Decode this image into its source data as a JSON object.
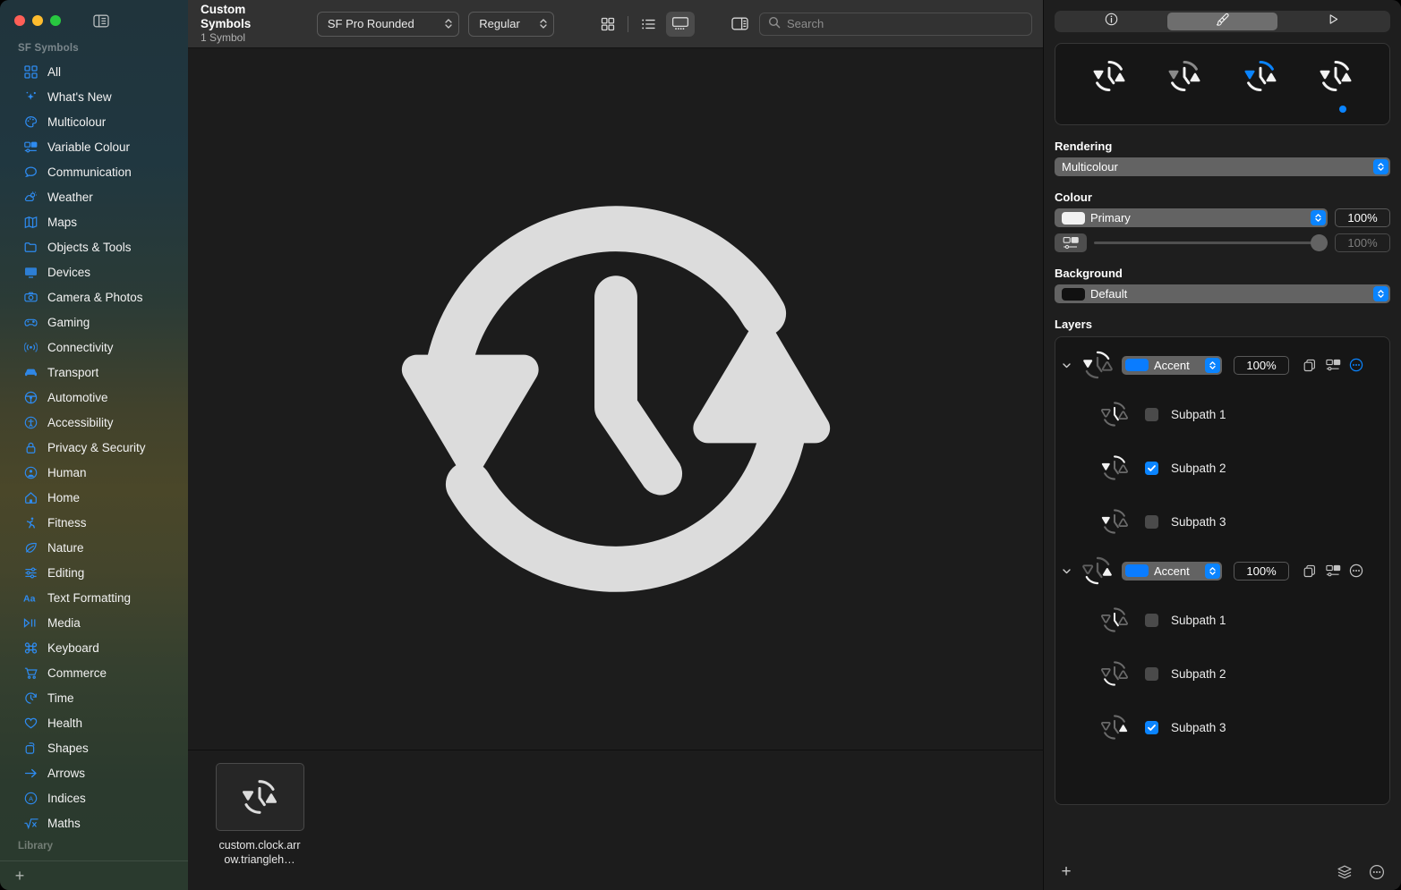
{
  "window": {
    "traffic_lights": [
      "close",
      "minimize",
      "zoom"
    ],
    "accent_color": "#0a84ff"
  },
  "sidebar": {
    "section_title": "SF Symbols",
    "library_title": "Library",
    "add_label": "+",
    "items": [
      {
        "label": "All",
        "icon": "grid-icon"
      },
      {
        "label": "What's New",
        "icon": "sparkles-icon"
      },
      {
        "label": "Multicolour",
        "icon": "paintpalette-icon"
      },
      {
        "label": "Variable Colour",
        "icon": "variable-colour-icon"
      },
      {
        "label": "Communication",
        "icon": "bubble-icon"
      },
      {
        "label": "Weather",
        "icon": "cloud-sun-icon"
      },
      {
        "label": "Maps",
        "icon": "map-icon"
      },
      {
        "label": "Objects & Tools",
        "icon": "folder-icon"
      },
      {
        "label": "Devices",
        "icon": "display-icon"
      },
      {
        "label": "Camera & Photos",
        "icon": "camera-icon"
      },
      {
        "label": "Gaming",
        "icon": "gamecontroller-icon"
      },
      {
        "label": "Connectivity",
        "icon": "wifi-icon"
      },
      {
        "label": "Transport",
        "icon": "car-icon"
      },
      {
        "label": "Automotive",
        "icon": "steeringwheel-icon"
      },
      {
        "label": "Accessibility",
        "icon": "accessibility-icon"
      },
      {
        "label": "Privacy & Security",
        "icon": "lock-icon"
      },
      {
        "label": "Human",
        "icon": "person-circle-icon"
      },
      {
        "label": "Home",
        "icon": "house-icon"
      },
      {
        "label": "Fitness",
        "icon": "figure-run-icon"
      },
      {
        "label": "Nature",
        "icon": "leaf-icon"
      },
      {
        "label": "Editing",
        "icon": "sliders-icon"
      },
      {
        "label": "Text Formatting",
        "icon": "textformat-icon"
      },
      {
        "label": "Media",
        "icon": "playpause-icon"
      },
      {
        "label": "Keyboard",
        "icon": "command-icon"
      },
      {
        "label": "Commerce",
        "icon": "cart-icon"
      },
      {
        "label": "Time",
        "icon": "clock-arrow-icon"
      },
      {
        "label": "Health",
        "icon": "heart-icon"
      },
      {
        "label": "Shapes",
        "icon": "shapes-icon"
      },
      {
        "label": "Arrows",
        "icon": "arrow-right-icon"
      },
      {
        "label": "Indices",
        "icon": "a-circle-icon"
      },
      {
        "label": "Maths",
        "icon": "sqrt-icon"
      }
    ]
  },
  "toolbar": {
    "title": "Custom Symbols",
    "subtitle": "1 Symbol",
    "font_popup": "SF Pro Rounded",
    "weight_popup": "Regular",
    "view_modes": [
      {
        "name": "grid-view",
        "selected": false
      },
      {
        "name": "list-view",
        "selected": false
      },
      {
        "name": "gallery-view",
        "selected": true
      }
    ],
    "search": {
      "placeholder": "Search",
      "value": ""
    }
  },
  "canvas": {
    "symbol_name": "custom.clock.arrow.triangleh…",
    "symbol_glyph": "clock-arrow-trianglehead-2-counterclockwise-rotate-90"
  },
  "inspector": {
    "tabs": [
      {
        "name": "info-tab",
        "icon": "info-circle-icon",
        "selected": false
      },
      {
        "name": "appearance-tab",
        "icon": "paintbrush-icon",
        "selected": true
      },
      {
        "name": "animation-tab",
        "icon": "play-triangle-icon",
        "selected": false
      }
    ],
    "previews": [
      {
        "name": "monochrome-preview",
        "selected": false
      },
      {
        "name": "hierarchical-preview",
        "selected": false
      },
      {
        "name": "palette-preview",
        "selected": false
      },
      {
        "name": "multicolour-preview",
        "selected": true
      }
    ],
    "rendering": {
      "label": "Rendering",
      "value": "Multicolour"
    },
    "colour": {
      "label": "Colour",
      "value": "Primary",
      "swatch": "#f2f2f2",
      "opacity": "100%",
      "variable_value": "100%"
    },
    "background": {
      "label": "Background",
      "value": "Default",
      "swatch": "#111111"
    },
    "layers": {
      "label": "Layers",
      "groups": [
        {
          "name": "layer-group-1",
          "colour_label": "Accent",
          "colour_swatch": "#0a7cff",
          "opacity": "100%",
          "more_highlighted": true,
          "subpaths": [
            {
              "label": "Subpath 1",
              "checked": false
            },
            {
              "label": "Subpath 2",
              "checked": true
            },
            {
              "label": "Subpath 3",
              "checked": false
            }
          ]
        },
        {
          "name": "layer-group-2",
          "colour_label": "Accent",
          "colour_swatch": "#0a7cff",
          "opacity": "100%",
          "more_highlighted": false,
          "subpaths": [
            {
              "label": "Subpath 1",
              "checked": false
            },
            {
              "label": "Subpath 2",
              "checked": false
            },
            {
              "label": "Subpath 3",
              "checked": true
            }
          ]
        }
      ]
    },
    "bottom_bar": {
      "add_label": "+",
      "layers_icon": "stack-icon",
      "more_icon": "ellipsis-circle-icon"
    }
  }
}
